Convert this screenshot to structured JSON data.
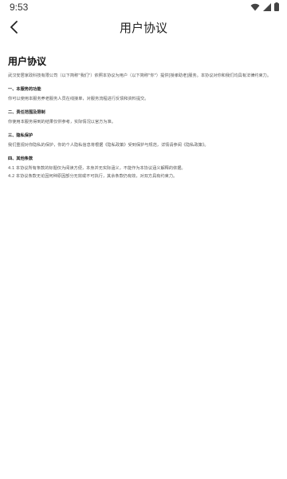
{
  "status_bar": {
    "time": "9:53"
  },
  "header": {
    "title": "用户协议"
  },
  "document": {
    "title": "用户协议",
    "intro": "武汉安居家政科技有限公司（以下简称\"我们\"）依照本协议为用户（以下简称\"你\"）提供[授孝助老]服务。本协议对你和我们均具有法律约束力。",
    "sections": [
      {
        "heading": "一、本服务的功能",
        "paragraphs": [
          "你可以使用本服务养老服务人员在线接单，对服务流程进行反馈和资料提交。"
        ]
      },
      {
        "heading": "二、责任范围及限制",
        "paragraphs": [
          "你使用本服务得到的结果仅供参考，实际情况以官方为准。"
        ]
      },
      {
        "heading": "三、隐私保护",
        "paragraphs": [
          "我们重视对你隐私的保护，你的个人隐私信息将根据《隐私政策》受到保护与规范，详情请参阅《隐私政策》。"
        ]
      },
      {
        "heading": "四、其他条款",
        "paragraphs": [
          "4.1 本协议所有条款的标题仅为阅读方便，本身并无实际涵义，不能作为本协议涵义解释的依据。",
          "4.2 本协议条款无论因何种原因部分无效或不可执行，其余条款仍有效，对双方具有约束力。"
        ]
      }
    ]
  }
}
